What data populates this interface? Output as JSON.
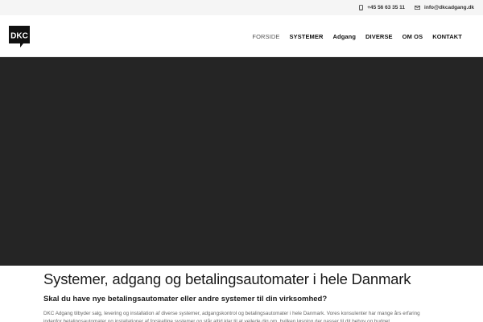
{
  "topbar": {
    "phone": "+45 56 63 35 11",
    "email": "info@dkcadgang.dk",
    "phone_icon": "phone-icon",
    "email_icon": "envelope-icon"
  },
  "logo": {
    "text": "DKC"
  },
  "nav": {
    "items": [
      "FORSIDE",
      "SYSTEMER",
      "Adgang",
      "DIVERSE",
      "OM OS",
      "KONTAKT"
    ],
    "active": "FORSIDE"
  },
  "main": {
    "title": "Systemer, adgang og betalingsautomater i hele Danmark",
    "subtitle": "Skal du have nye betalingsautomater eller andre systemer til din virksomhed?",
    "body": "DKC Adgang tilbyder salg, levering og installation af diverse systemer, adgangskontrol og betalingsautomater i hele Danmark. Vores konsulenter har mange års erfaring indenfor betalingsautomater og installationer af forskellige systemer og står altid klar til at vejlede dig om, hvilken løsning der passer til dit behov og budget."
  },
  "colors": {
    "hero": "#252525",
    "topbar": "#f5f5f5",
    "accent": "#111111"
  }
}
